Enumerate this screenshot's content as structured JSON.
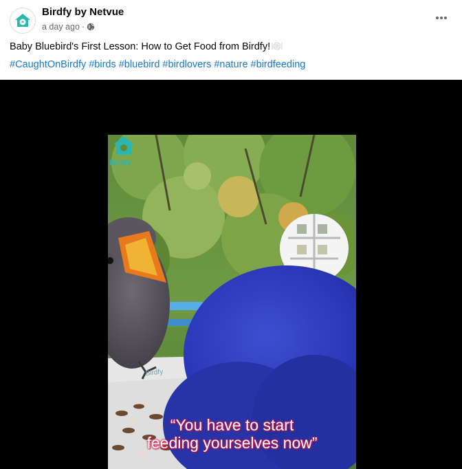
{
  "post": {
    "author": "Birdfy by Netvue",
    "time": "a day ago",
    "separator": "·",
    "caption": "Baby Bluebird's First Lesson: How to Get Food from Birdfy!",
    "hashtags": [
      "#CaughtOnBirdfy",
      "#birds",
      "#bluebird",
      "#birdlovers",
      "#nature",
      "#birdfeeding"
    ]
  },
  "video": {
    "watermark": "Birdfy",
    "feeder_label": "Birdfy",
    "subtitle_line1": "“You have to start",
    "subtitle_line2": "feeding yourselves now”"
  },
  "icons": {
    "avatar": "birdfy-logo-icon",
    "audience": "globe-icon",
    "more": "more-options-icon"
  },
  "colors": {
    "hashtag": "#1877c8",
    "brand_teal": "#2ab7b0",
    "subtitle_glow": "#e0194e"
  }
}
